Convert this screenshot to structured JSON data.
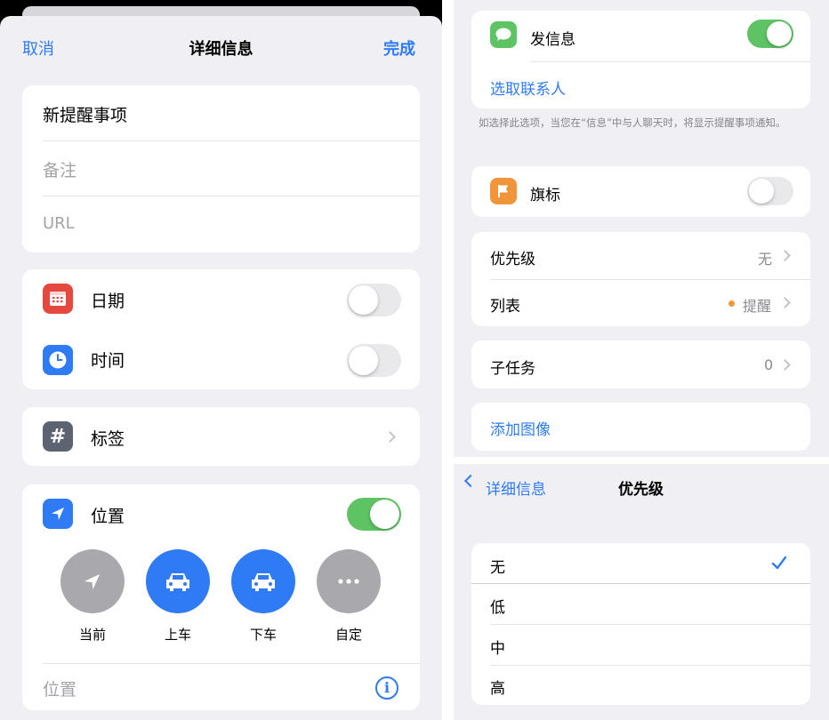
{
  "left": {
    "nav": {
      "cancel": "取消",
      "title": "详细信息",
      "done": "完成"
    },
    "fields": {
      "title_value": "新提醒事项",
      "notes_placeholder": "备注",
      "url_placeholder": "URL"
    },
    "date": {
      "label": "日期",
      "enabled": false
    },
    "time": {
      "label": "时间",
      "enabled": false
    },
    "tags": {
      "label": "标签"
    },
    "location": {
      "label": "位置",
      "enabled": true,
      "options": [
        {
          "label": "当前",
          "icon": "location-arrow-icon",
          "color": "#a9a9ad"
        },
        {
          "label": "上车",
          "icon": "car-icon",
          "color": "#2f7bf5"
        },
        {
          "label": "下车",
          "icon": "car-icon",
          "color": "#2f7bf5"
        },
        {
          "label": "自定",
          "icon": "more-icon",
          "color": "#a9a9ad"
        }
      ],
      "field_placeholder": "位置"
    }
  },
  "right_top": {
    "message": {
      "label": "发信息",
      "enabled": true,
      "choose_contact": "选取联系人"
    },
    "message_hint": "如选择此选项，当您在“信息”中与人聊天时，将显示提醒事项通知。",
    "flag": {
      "label": "旗标",
      "enabled": false
    },
    "priority": {
      "label": "优先级",
      "value": "无"
    },
    "list": {
      "label": "列表",
      "value": "提醒",
      "dot_color": "#f0953a"
    },
    "subtasks": {
      "label": "子任务",
      "value": "0"
    },
    "add_image": "添加图像"
  },
  "right_bottom": {
    "nav": {
      "back": "详细信息",
      "title": "优先级"
    },
    "options": [
      "无",
      "低",
      "中",
      "高"
    ],
    "selected": "无"
  },
  "colors": {
    "accent": "#2f7bf5",
    "toggle_on": "#5dc363",
    "calendar_tile": "#e5483f",
    "clock_tile": "#2f7bf5",
    "tag_tile": "#5b6470",
    "message_tile": "#5dc363",
    "flag_tile": "#f0953a"
  }
}
